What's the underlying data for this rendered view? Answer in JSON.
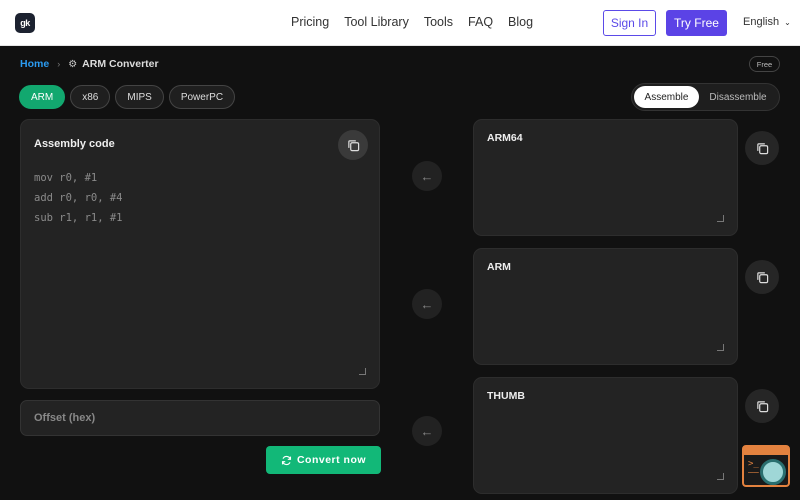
{
  "header": {
    "logo_text": "gk",
    "nav": [
      "Pricing",
      "Tool Library",
      "Tools",
      "FAQ",
      "Blog"
    ],
    "sign_in": "Sign In",
    "try_free": "Try Free",
    "language": "English"
  },
  "breadcrumb": {
    "home": "Home",
    "current": "ARM Converter"
  },
  "badge": "Free",
  "arch_tabs": [
    "ARM",
    "x86",
    "MIPS",
    "PowerPC"
  ],
  "active_arch": "ARM",
  "mode": {
    "assemble": "Assemble",
    "disassemble": "Disassemble",
    "active": "Assemble"
  },
  "input": {
    "title": "Assembly code",
    "placeholder_lines": "mov r0, #1\nadd r0, r0, #4\nsub r1, r1, #1"
  },
  "offset": {
    "placeholder": "Offset (hex)"
  },
  "convert_label": "Convert now",
  "outputs": [
    {
      "title": "ARM64"
    },
    {
      "title": "ARM"
    },
    {
      "title": "THUMB"
    }
  ],
  "colors": {
    "accent_green": "#12b878",
    "brand_purple": "#5b43e6",
    "link_blue": "#2b9bf0",
    "widget_orange": "#e3823f"
  }
}
